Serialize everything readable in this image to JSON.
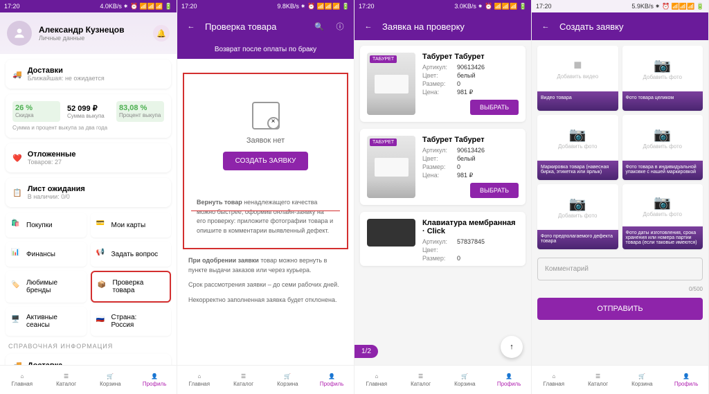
{
  "status": {
    "time": "17:20",
    "speeds": [
      "4.0KB/s",
      "9.8KB/s",
      "3.0KB/s",
      "5.9KB/s"
    ],
    "icons": "⏰ 📶 📶 📶 🔋"
  },
  "s1": {
    "profile": {
      "name": "Александр Кузнецов",
      "sub": "Личные данные"
    },
    "delivery": {
      "label": "Доставки",
      "sub": "Ближайшая: не ожидается"
    },
    "stats": [
      {
        "val": "26 %",
        "lbl": "Скидка"
      },
      {
        "val": "52 099 ₽",
        "lbl": "Сумма выкупа"
      },
      {
        "val": "83,08 %",
        "lbl": "Процент выкупа"
      }
    ],
    "stats_sub": "Сумма и процент выкупа за два года",
    "pending": {
      "label": "Отложенные",
      "sub": "Товаров: 27"
    },
    "waitlist": {
      "label": "Лист ожидания",
      "sub": "В наличии: 0/0"
    },
    "menu": [
      "Покупки",
      "Мои карты",
      "Финансы",
      "Задать вопрос",
      "Любимые бренды",
      "Проверка товара",
      "Активные сеансы",
      "Страна:\nРоссия"
    ],
    "section": "СПРАВОЧНАЯ ИНФОРМАЦИЯ",
    "ref": "Доставка"
  },
  "s2": {
    "title": "Проверка товара",
    "tab": "Возврат после оплаты по браку",
    "empty": "Заявок нет",
    "btn": "СОЗДАТЬ ЗАЯВКУ",
    "info1": "Вернуть товар ненадлежащего качества можно быстрее, оформив онлайн-заявку на его проверку: приложите фотографии товара и опишите в комментарии выявленный дефект.",
    "info2": "При одобрении заявки товар можно вернуть в пункте выдачи заказов или через курьера.",
    "info3": "Срок рассмотрения заявки – до семи рабочих дней.",
    "info4": "Некорректно заполненная заявка будет отклонена."
  },
  "s3": {
    "title": "Заявка на проверку",
    "products": [
      {
        "title": "Табурет Табурет",
        "badge": "ТАБУРЕТ",
        "art": "90613426",
        "color": "белый",
        "size": "0",
        "price": "981 ₽"
      },
      {
        "title": "Табурет Табурет",
        "badge": "ТАБУРЕТ",
        "art": "90613426",
        "color": "белый",
        "size": "0",
        "price": "981 ₽"
      },
      {
        "title": "Клавиатура мембранная · Click",
        "art": "57837845",
        "color": "",
        "size": "0"
      }
    ],
    "labels": {
      "art": "Артикул:",
      "color": "Цвет:",
      "size": "Размер:",
      "price": "Цена:"
    },
    "select": "ВЫБРАТЬ",
    "page": "1/2"
  },
  "s4": {
    "title": "Создать заявку",
    "cells": [
      {
        "icon": "video",
        "lbl": "Добавить видео",
        "cap": "Видео товара"
      },
      {
        "icon": "photo",
        "lbl": "Добавить фото",
        "cap": "Фото товара целиком"
      },
      {
        "icon": "photo",
        "lbl": "Добавить фото",
        "cap": "Маркировка товара (навесная бирка, этикетка или ярлык)"
      },
      {
        "icon": "photo",
        "lbl": "Добавить фото",
        "cap": "Фото товара в индивидуальной упаковке с нашей маркировкой"
      },
      {
        "icon": "photo",
        "lbl": "Добавить фото",
        "cap": "Фото предполагаемого дефекта товара"
      },
      {
        "icon": "photo",
        "lbl": "Добавить фото",
        "cap": "Фото даты изготовления, срока хранения или номера партии товара (если таковые имеются)"
      }
    ],
    "comment": "Комментарий",
    "count": "0/500",
    "submit": "ОТПРАВИТЬ"
  },
  "nav": [
    "Главная",
    "Каталог",
    "Корзина",
    "Профиль"
  ]
}
